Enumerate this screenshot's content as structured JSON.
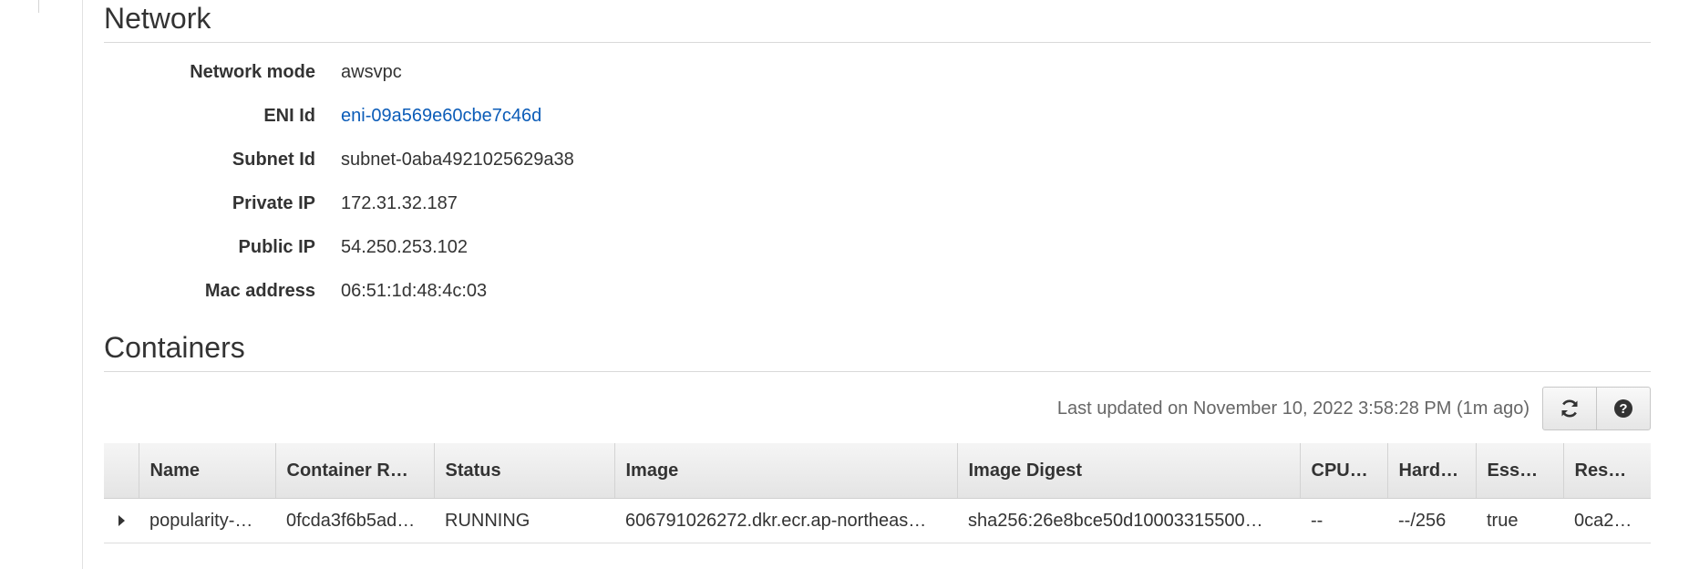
{
  "network": {
    "title": "Network",
    "fields": [
      {
        "label": "Network mode",
        "value": "awsvpc"
      },
      {
        "label": "ENI Id",
        "value": "eni-09a569e60cbe7c46d"
      },
      {
        "label": "Subnet Id",
        "value": "subnet-0aba4921025629a38"
      },
      {
        "label": "Private IP",
        "value": "172.31.32.187"
      },
      {
        "label": "Public IP",
        "value": "54.250.253.102"
      },
      {
        "label": "Mac address",
        "value": "06:51:1d:48:4c:03"
      }
    ]
  },
  "containers": {
    "title": "Containers",
    "last_updated": "Last updated on November 10, 2022 3:58:28 PM (1m ago)",
    "refresh_icon": "refresh-icon",
    "help_icon": "help-icon",
    "columns": [
      "Name",
      "Container R…",
      "Status",
      "Image",
      "Image Digest",
      "CPU…",
      "Hard…",
      "Ess…",
      "Res…"
    ],
    "rows": [
      {
        "name": "popularity-…",
        "container_runtime": "0fcda3f6b5ad…",
        "status": "RUNNING",
        "image": "606791026272.dkr.ecr.ap-northeas…",
        "image_digest": "sha256:26e8bce50d10003315500…",
        "cpu": "--",
        "hard": "--/256",
        "essential": "true",
        "res": "0ca2…"
      }
    ],
    "status_color": "#1d8102",
    "link_color": "#0b5cb8"
  }
}
